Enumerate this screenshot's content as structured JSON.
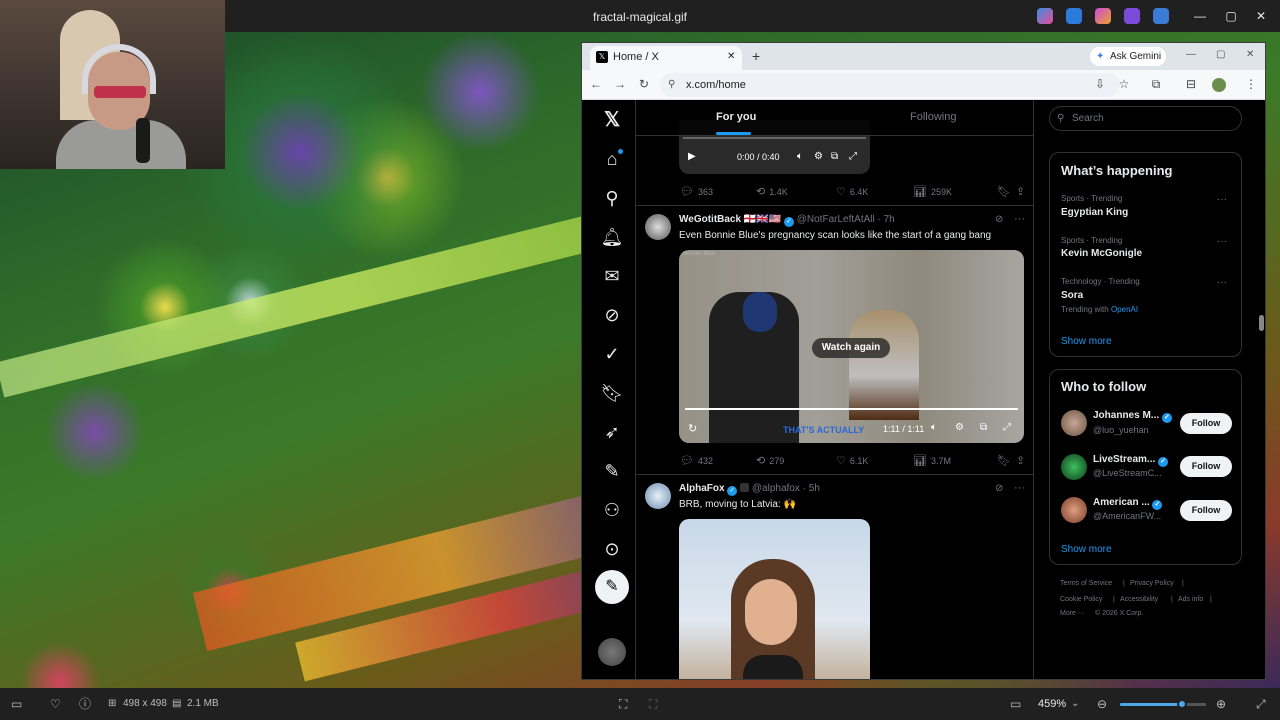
{
  "viewer": {
    "title": "fractal-magical.gif",
    "minimize": "—",
    "maximize": "▢",
    "close": "✕",
    "dimensions": "498 x 498",
    "filesize": "2.1 MB",
    "zoom": "459%",
    "zoom_slider_value": 0.72
  },
  "browser": {
    "tab_title": "Home / X",
    "tab_close": "✕",
    "new_tab": "+",
    "gemini_label": "Ask Gemini",
    "url": "x.com/home"
  },
  "feed": {
    "tabs": [
      {
        "label": "For you"
      },
      {
        "label": "Following"
      }
    ],
    "video1": {
      "time": "0:00 / 0:40"
    },
    "tweet0_actions": {
      "replies": "363",
      "reposts": "1.4K",
      "likes": "6.4K",
      "views": "259K"
    },
    "tweet1": {
      "name": "WeGotitBack 🏴󠁧󠁢󠁥󠁮󠁧󠁿🇬🇧🇺🇸",
      "handle": "@NotFarLeftAtAll · 7h",
      "text": "Even Bonnie Blue's pregnancy scan looks like the start of a gang bang",
      "video_corner": "Bonnie Blue",
      "watch_again": "Watch again",
      "caption": "THAT'S ACTUALLY",
      "time": "1:11 / 1:11",
      "progress": 1.0,
      "actions": {
        "replies": "432",
        "reposts": "279",
        "likes": "6.1K",
        "views": "3.7M"
      }
    },
    "tweet2": {
      "name": "AlphaFox",
      "handle": "@alphafox · 5h",
      "text": "BRB, moving to Latvia: 🙌"
    }
  },
  "rail": {
    "search_placeholder": "Search",
    "whats_happening": "What’s happening",
    "trends": [
      {
        "meta": "Sports · Trending",
        "name": "Egyptian King",
        "extra": ""
      },
      {
        "meta": "Sports · Trending",
        "name": "Kevin McGonigle",
        "extra": ""
      },
      {
        "meta": "Technology · Trending",
        "name": "Sora",
        "extra_prefix": "Trending with ",
        "extra": "OpenAI"
      }
    ],
    "show_more": "Show more",
    "who_to_follow": "Who to follow",
    "follows": [
      {
        "name": "Johannes M...",
        "handle": "@luo_yuehan",
        "button": "Follow"
      },
      {
        "name": "LiveStream...",
        "handle": "@LiveStreamC...",
        "button": "Follow"
      },
      {
        "name": "American ...",
        "handle": "@AmericanFW...",
        "button": "Follow"
      }
    ],
    "show_more_2": "Show more",
    "footer": {
      "terms": "Terms of Service",
      "privacy": "Privacy Policy",
      "cookie": "Cookie Policy",
      "accessibility": "Accessibility",
      "ads": "Ads info",
      "more": "More ···",
      "copyright": "© 2026 X Corp."
    }
  },
  "colors": {
    "accent": "#1d9bf0",
    "background": "#000000",
    "text": "#e7e9ea",
    "muted": "#71767b"
  }
}
